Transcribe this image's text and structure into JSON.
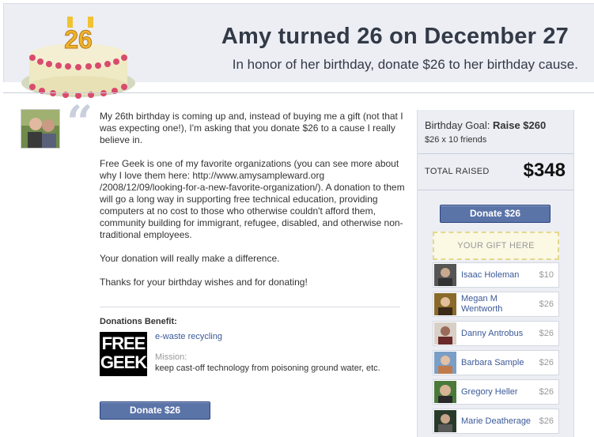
{
  "header": {
    "cake_number": "26",
    "title": "Amy turned 26 on December 27",
    "subtitle": "In honor of her birthday, donate $26 to her birthday cause."
  },
  "message": {
    "paragraphs": [
      "My 26th birthday is coming up and, instead of buying me a gift (not that I was expecting one!), I'm asking that you donate $26 to a cause I really believe in.",
      "Free Geek is one of my favorite organizations (you can see more about why I love them here: http://www.amysampleward.org /2008/12/09/looking-for-a-new-favorite-organization/). A donation to them will go a long way in supporting free technical education, providing computers at no cost to those who otherwise couldn't afford them, community building for immigrant, refugee, disabled, and otherwise non-traditional employees.",
      "Your donation will really make a difference.",
      "Thanks for your birthday wishes and for donating!"
    ]
  },
  "benefit": {
    "label": "Donations Benefit:",
    "logo_line1": "FREE",
    "logo_line2": "GEEK",
    "cause": "e-waste recycling",
    "mission_label": "Mission:",
    "mission": "keep cast-off technology from poisoning ground water, etc."
  },
  "donate_label": "Donate $26",
  "sidebar": {
    "goal_prefix": "Birthday Goal:",
    "goal_value": "Raise $260",
    "goal_sub": "$26 x 10 friends",
    "raised_label": "TOTAL RAISED",
    "raised_value": "$348",
    "gift_placeholder": "YOUR GIFT HERE",
    "donors": [
      {
        "name": "Isaac Holeman",
        "amount": "$10"
      },
      {
        "name": "Megan M Wentworth",
        "amount": "$26"
      },
      {
        "name": "Danny Antrobus",
        "amount": "$26"
      },
      {
        "name": "Barbara Sample",
        "amount": "$26"
      },
      {
        "name": "Gregory Heller",
        "amount": "$26"
      },
      {
        "name": "Marie Deatherage",
        "amount": "$26"
      }
    ]
  },
  "colors": {
    "header_bg": "#eceef4",
    "link": "#3b5998",
    "button": "#5b74a8"
  }
}
